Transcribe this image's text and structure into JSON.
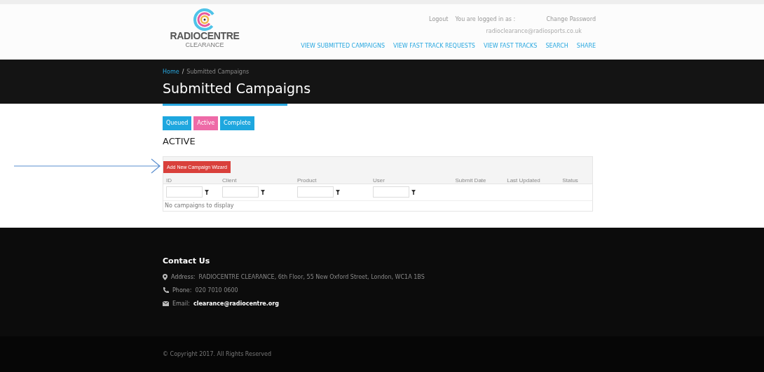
{
  "logo": {
    "name": "RADIOCENTRE",
    "sub": "CLEARANCE"
  },
  "account": {
    "logout": "Logout",
    "logged_in": "You are logged in as :",
    "email": "radioclearance@radiosports.co.uk",
    "change_password": "Change Password"
  },
  "nav": [
    "VIEW SUBMITTED CAMPAIGNS",
    "VIEW FAST TRACK REQUESTS",
    "VIEW FAST TRACKS",
    "SEARCH",
    "SHARE"
  ],
  "breadcrumb": {
    "home": "Home",
    "separator": "/",
    "current": "Submitted Campaigns"
  },
  "page_title": "Submitted Campaigns",
  "tabs": [
    {
      "label": "Queued",
      "selected": false
    },
    {
      "label": "Active",
      "selected": true
    },
    {
      "label": "Complete",
      "selected": false
    }
  ],
  "section_title": "ACTIVE",
  "add_button": "Add New Campaign Wizard",
  "table": {
    "columns": [
      {
        "label": "ID",
        "filter": true
      },
      {
        "label": "Client",
        "filter": true
      },
      {
        "label": "Product",
        "filter": true
      },
      {
        "label": "User",
        "filter": true
      },
      {
        "label": "Submit Date",
        "filter": false
      },
      {
        "label": "Last Updated",
        "filter": false
      },
      {
        "label": "Status",
        "filter": false
      }
    ],
    "empty": "No campaigns to display"
  },
  "footer": {
    "title": "Contact Us",
    "items": [
      {
        "kind": "address",
        "label": "Address:",
        "value": "RADIOCENTRE CLEARANCE, 6th Floor, 55 New Oxford Street, London, WC1A 1BS"
      },
      {
        "kind": "phone",
        "label": "Phone:",
        "value": "020 7010 0600"
      },
      {
        "kind": "email",
        "label": "Email:",
        "value": "clearance@radiocentre.org"
      }
    ],
    "copyright": "© Copyright 2017. All Rights Reserved"
  }
}
